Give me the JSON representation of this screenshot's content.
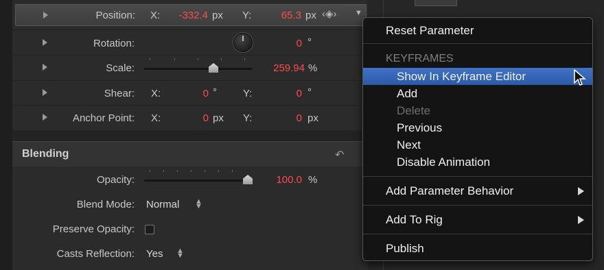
{
  "transform": {
    "position": {
      "label": "Position:",
      "x_axis": "X:",
      "x": "-332.4",
      "x_unit": "px",
      "y_axis": "Y:",
      "y": "65.3",
      "y_unit": "px"
    },
    "rotation": {
      "label": "Rotation:",
      "value": "0",
      "unit": "°"
    },
    "scale": {
      "label": "Scale:",
      "value": "259.94",
      "unit": "%"
    },
    "shear": {
      "label": "Shear:",
      "x_axis": "X:",
      "x": "0",
      "x_unit": "°",
      "y_axis": "Y:",
      "y": "0",
      "y_unit": "°"
    },
    "anchor": {
      "label": "Anchor Point:",
      "x_axis": "X:",
      "x": "0",
      "x_unit": "px",
      "y_axis": "Y:",
      "y": "0",
      "y_unit": "px"
    }
  },
  "blending": {
    "title": "Blending",
    "opacity": {
      "label": "Opacity:",
      "value": "100.0",
      "unit": "%"
    },
    "blend_mode": {
      "label": "Blend Mode:",
      "value": "Normal"
    },
    "preserve_opacity": {
      "label": "Preserve Opacity:"
    },
    "casts_reflection": {
      "label": "Casts Reflection:",
      "value": "Yes"
    }
  },
  "menu": {
    "reset": "Reset Parameter",
    "keyframes_header": "KEYFRAMES",
    "show_in_editor": "Show In Keyframe Editor",
    "add": "Add",
    "delete": "Delete",
    "previous": "Previous",
    "next": "Next",
    "disable_animation": "Disable Animation",
    "add_behavior": "Add Parameter Behavior",
    "add_to_rig": "Add To Rig",
    "publish": "Publish"
  },
  "colors": {
    "value_red": "#ff4b4b",
    "highlight": "#2f5fae"
  }
}
